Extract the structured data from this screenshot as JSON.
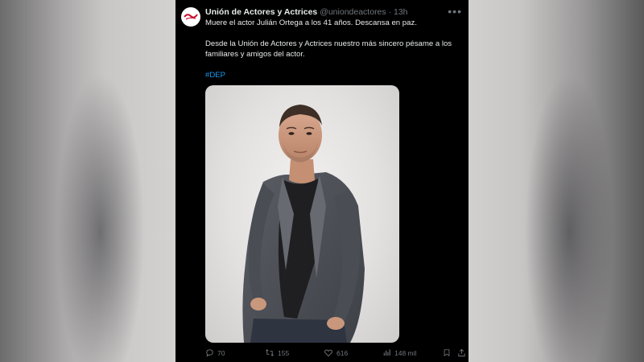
{
  "tweet": {
    "display_name": "Unión de Actores y Actrices",
    "handle": "@uniondeactores",
    "separator": "·",
    "time": "13h",
    "text_line1": "Muere el actor Julián Ortega a los 41 años. Descansa en paz.",
    "text_line2": "Desde la Unión de Actores y Actrices nuestro más sincero pésame a los familiares y amigos del actor.",
    "hashtag": "#DEP",
    "more_icon": "more-dots-icon",
    "image": "portrait of a man in a grey coat and black t-shirt"
  },
  "actions": {
    "replies": "70",
    "retweets": "155",
    "likes": "616",
    "views": "148 mil"
  },
  "icons": [
    "reply-icon",
    "retweet-icon",
    "like-icon",
    "views-icon",
    "bookmark-icon",
    "share-icon"
  ],
  "colors": {
    "background": "#000000",
    "text": "#e7e9ea",
    "muted": "#71767b",
    "link": "#1d9bf0"
  }
}
